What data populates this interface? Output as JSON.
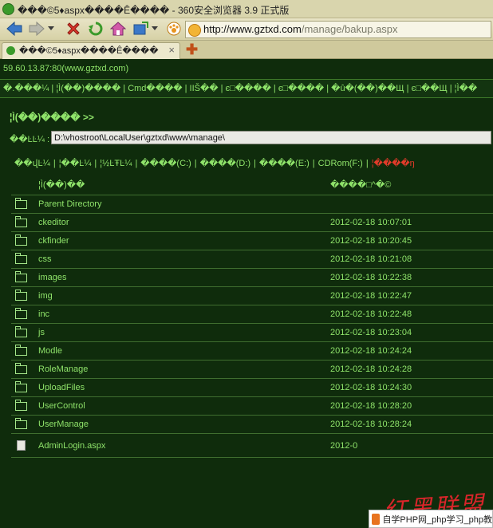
{
  "window": {
    "title": "���©5♦aspx����Ê���� - 360安全浏览器 3.9 正式版"
  },
  "toolbar": {
    "icons": [
      "back-icon",
      "forward-icon",
      "dropdown-icon",
      "stop-icon",
      "refresh-icon",
      "home-icon",
      "favorites-icon",
      "dropdown-icon",
      "paw-icon"
    ],
    "url_host": "http://www.gztxd.com",
    "url_path": "/manage/bakup.aspx"
  },
  "tabs": [
    {
      "label": "���©5♦aspx����Ê����",
      "close": "×"
    }
  ],
  "newtab_symbol": "✚",
  "page": {
    "server": "59.60.13.87:80(www.gztxd.com)",
    "nav": "�.���¼ | ¦Ì(��)���� | Cmd���� | IIŠ�� | є□���� | є□���� | �û�(��)��Щ | є□��Щ | ¦Ì��",
    "section_title": "¦Ì(��)���� >>",
    "path_label": "��ĿĿ¼ :",
    "path_value": "D:\\vhostroot\\LocalUser\\gztxd\\www\\manage\\",
    "drives": [
      {
        "label": "��վĿ¼",
        "active": false
      },
      {
        "label": "¦��Ŀ¼",
        "active": false
      },
      {
        "label": "¦½ĿŦĿ¼",
        "active": false
      },
      {
        "label": "����(C:)",
        "active": false
      },
      {
        "label": "����(D:)",
        "active": false
      },
      {
        "label": "����(E:)",
        "active": false
      },
      {
        "label": "CDRom(F:)",
        "active": false
      },
      {
        "label": "¦����ŋ",
        "active": true
      }
    ],
    "table": {
      "headers": {
        "name": "¦Ì(��)��",
        "date": "����□^�©"
      },
      "rows": [
        {
          "icon": "folder",
          "name": "Parent Directory",
          "date": ""
        },
        {
          "icon": "folder",
          "name": "ckeditor",
          "date": "2012-02-18 10:07:01"
        },
        {
          "icon": "folder",
          "name": "ckfinder",
          "date": "2012-02-18 10:20:45"
        },
        {
          "icon": "folder",
          "name": "css",
          "date": "2012-02-18 10:21:08"
        },
        {
          "icon": "folder",
          "name": "images",
          "date": "2012-02-18 10:22:38"
        },
        {
          "icon": "folder",
          "name": "img",
          "date": "2012-02-18 10:22:47"
        },
        {
          "icon": "folder",
          "name": "inc",
          "date": "2012-02-18 10:22:48"
        },
        {
          "icon": "folder",
          "name": "js",
          "date": "2012-02-18 10:23:04"
        },
        {
          "icon": "folder",
          "name": "Modle",
          "date": "2012-02-18 10:24:24"
        },
        {
          "icon": "folder",
          "name": "RoleManage",
          "date": "2012-02-18 10:24:28"
        },
        {
          "icon": "folder",
          "name": "UploadFiles",
          "date": "2012-02-18 10:24:30"
        },
        {
          "icon": "folder",
          "name": "UserControl",
          "date": "2012-02-18 10:28:20"
        },
        {
          "icon": "folder",
          "name": "UserManage",
          "date": "2012-02-18 10:28:24"
        },
        {
          "icon": "file",
          "name": "AdminLogin.aspx",
          "date": "2012-0"
        }
      ]
    }
  },
  "overlay": {
    "watermark": "红黑联盟",
    "ad_text": "自学PHP网_php学习_php教"
  }
}
